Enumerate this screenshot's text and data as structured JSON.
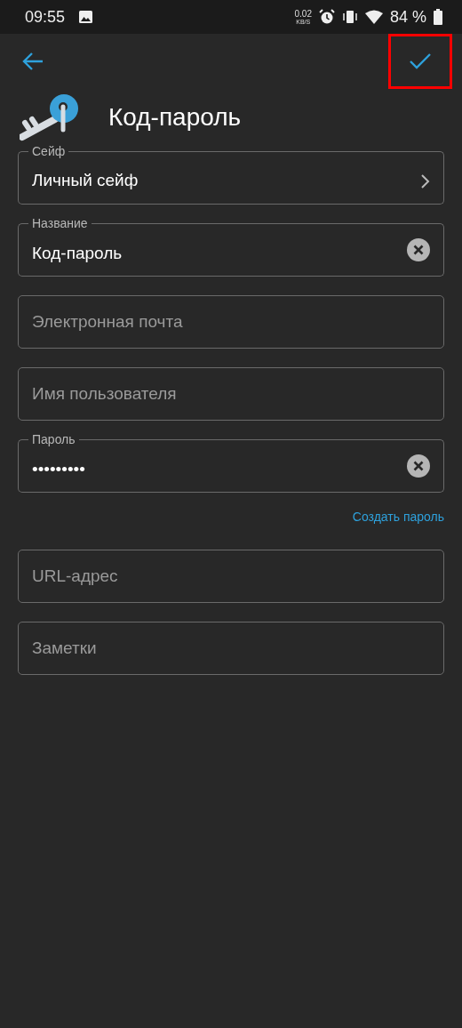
{
  "status_bar": {
    "time": "09:55",
    "net_speed": "0.02",
    "net_unit": "KB/S",
    "battery": "84 %"
  },
  "toolbar": {
    "save_highlighted": true
  },
  "header": {
    "title": "Код-пароль"
  },
  "fields": [
    {
      "kind": "select",
      "label": "Сейф",
      "value": "Личный сейф"
    },
    {
      "kind": "text",
      "label": "Название",
      "value": "Код-пароль",
      "clearable": true
    },
    {
      "kind": "text",
      "placeholder": "Электронная почта"
    },
    {
      "kind": "text",
      "placeholder": "Имя пользователя"
    },
    {
      "kind": "password",
      "label": "Пароль",
      "value": "•••••••••",
      "clearable": true,
      "action": "Создать пароль"
    },
    {
      "kind": "text",
      "placeholder": "URL-адрес"
    },
    {
      "kind": "text",
      "placeholder": "Заметки"
    }
  ]
}
